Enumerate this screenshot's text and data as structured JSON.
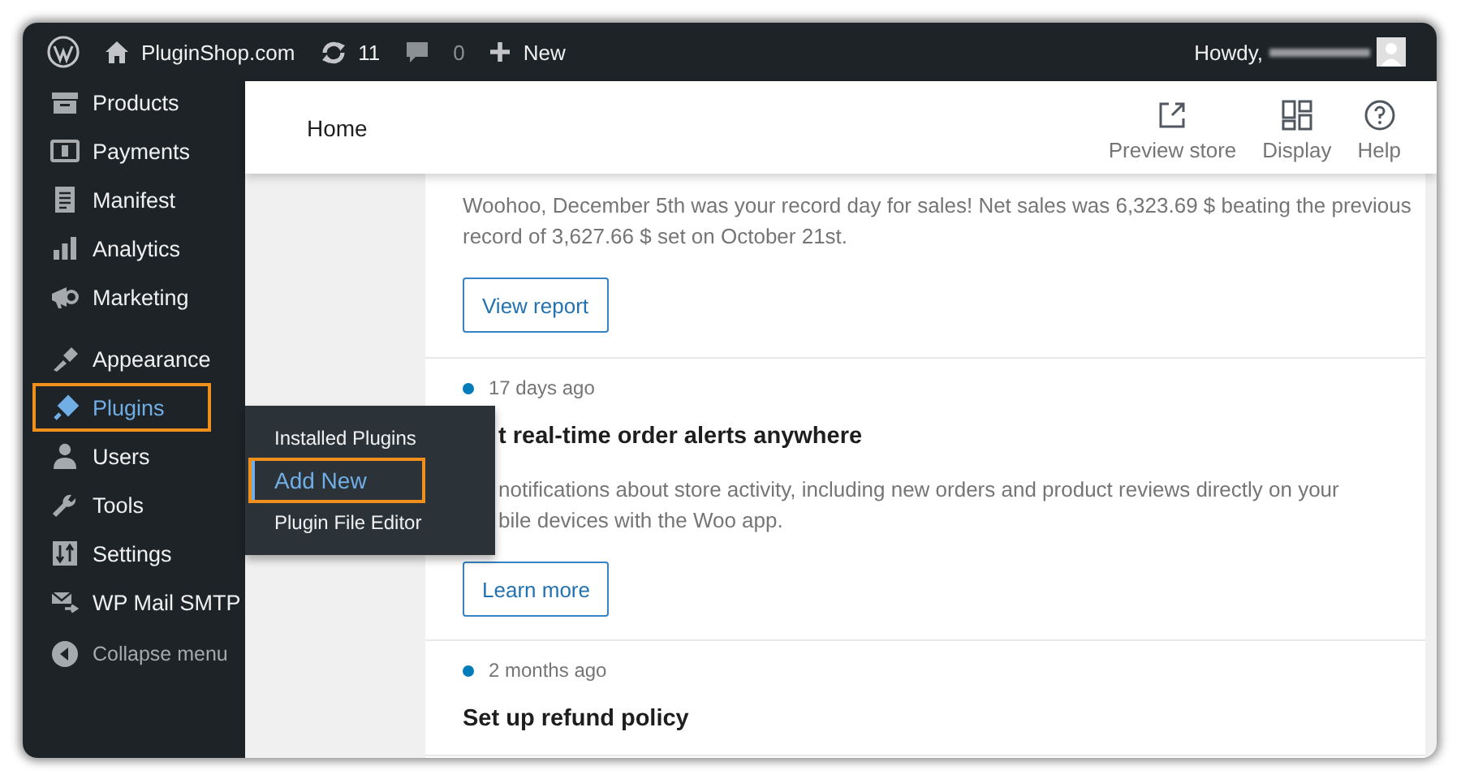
{
  "admin_bar": {
    "site": "PluginShop.com",
    "updates": "11",
    "comments": "0",
    "new_label": "New",
    "greeting": "Howdy,"
  },
  "sidebar": {
    "groups": [
      [
        {
          "label": "Products",
          "selected": false,
          "highlighted": false
        },
        {
          "label": "Payments",
          "selected": false,
          "highlighted": false
        },
        {
          "label": "Manifest",
          "selected": false,
          "highlighted": false
        },
        {
          "label": "Analytics",
          "selected": false,
          "highlighted": false
        },
        {
          "label": "Marketing",
          "selected": false,
          "highlighted": false
        }
      ],
      [
        {
          "label": "Appearance",
          "selected": false,
          "highlighted": false
        },
        {
          "label": "Plugins",
          "selected": true,
          "highlighted": true
        },
        {
          "label": "Users",
          "selected": false,
          "highlighted": false
        },
        {
          "label": "Tools",
          "selected": false,
          "highlighted": false
        },
        {
          "label": "Settings",
          "selected": false,
          "highlighted": false
        },
        {
          "label": "WP Mail SMTP",
          "selected": false,
          "highlighted": false
        }
      ]
    ],
    "collapse": "Collapse menu"
  },
  "flyout": {
    "items": [
      {
        "label": "Installed Plugins",
        "selected": false,
        "highlighted": false
      },
      {
        "label": "Add New",
        "selected": true,
        "highlighted": true
      },
      {
        "label": "Plugin File Editor",
        "selected": false,
        "highlighted": false
      }
    ]
  },
  "header": {
    "title": "Home",
    "actions": [
      {
        "label": "Preview store"
      },
      {
        "label": "Display"
      },
      {
        "label": "Help"
      }
    ]
  },
  "feed": [
    {
      "body_lines": [
        "Woohoo, December 5th was your record day for sales! Net sales was 6,323.69 $ beating the previous",
        "record of 3,627.66 $ set on October 21st."
      ],
      "button": "View report"
    },
    {
      "partly_hidden": true,
      "date": "17 days ago",
      "title": "t real-time order alerts anywhere",
      "body_lines": [
        "notifications about store activity, including new orders and product reviews directly on your",
        "bile devices with the Woo app."
      ],
      "button": "Learn more"
    },
    {
      "date": "2 months ago",
      "title": "Set up refund policy"
    }
  ]
}
